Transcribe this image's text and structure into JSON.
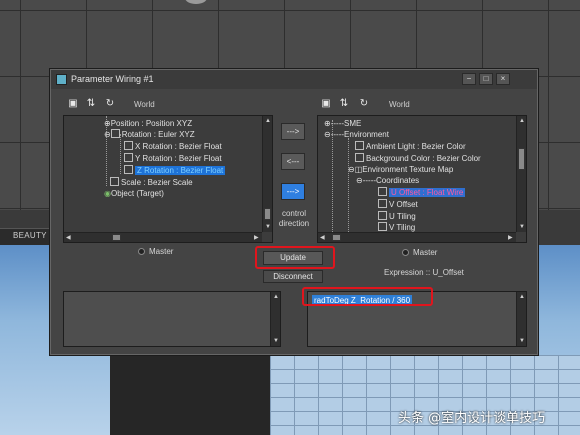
{
  "dialog": {
    "title": "Parameter Wiring #1",
    "window_buttons": [
      "−",
      "□",
      "×"
    ]
  },
  "left_panel": {
    "world_label": "World",
    "toolbar_icons": [
      "folder-icon",
      "expand-icon",
      "refresh-icon"
    ],
    "tree_items": [
      {
        "label": "Position : Position XYZ",
        "expander": "+"
      },
      {
        "label": "Rotation : Euler XYZ",
        "expander": "−"
      },
      {
        "label": "X Rotation : Bezier Float"
      },
      {
        "label": "Y Rotation : Bezier Float"
      },
      {
        "label": "Z Rotation : Bezier Float",
        "selected": true
      },
      {
        "label": "Scale : Bezier Scale"
      },
      {
        "label": "Object (Target)"
      }
    ],
    "master_label": "Master"
  },
  "right_panel": {
    "world_label": "World",
    "toolbar_icons": [
      "folder-icon",
      "expand-icon",
      "refresh-icon"
    ],
    "tree_items": [
      {
        "label": "SME",
        "expander": "+"
      },
      {
        "label": "Environment",
        "expander": "−"
      },
      {
        "label": "Ambient Light : Bezier Color"
      },
      {
        "label": "Background Color : Bezier Color"
      },
      {
        "label": "Environment Texture Map",
        "expander": "−"
      },
      {
        "label": "Coordinates",
        "expander": "−"
      },
      {
        "label": "U Offset : Float Wire",
        "selected": true
      },
      {
        "label": "V Offset"
      },
      {
        "label": "U Tiling"
      },
      {
        "label": "V Tiling"
      }
    ],
    "master_label": "Master",
    "expression_label": "Expression :: U_Offset"
  },
  "controls": {
    "arrow_right_left": "--->",
    "arrow_left": "<---",
    "arrow_right": "--->",
    "control_direction": [
      "control",
      "direction"
    ]
  },
  "buttons": {
    "update": "Update",
    "disconnect": "Disconnect"
  },
  "expression": {
    "left_value": "",
    "right_value": "radToDeg Z_Rotation / 360"
  },
  "background": {
    "tab_label": "BEAUTY",
    "watermark": "头条 @室内设计谈单技巧"
  },
  "colors": {
    "highlight": "#e0151d",
    "selection": "#1e73d8"
  }
}
